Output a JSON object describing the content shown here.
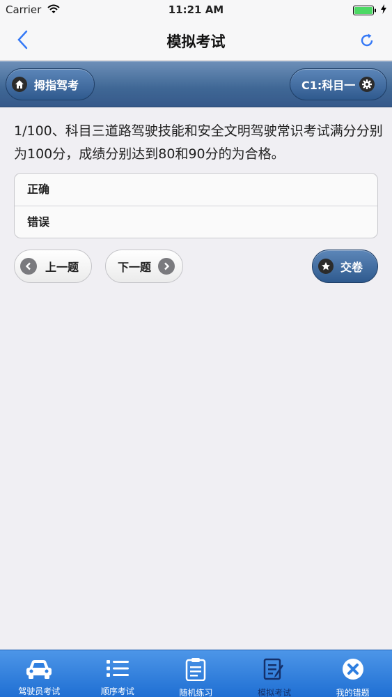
{
  "status_bar": {
    "carrier": "Carrier",
    "time": "11:21 AM"
  },
  "nav": {
    "title": "模拟考试"
  },
  "header": {
    "home_label": "拇指驾考",
    "subject_label": "C1:科目一"
  },
  "question": {
    "text": "1/100、科目三道路驾驶技能和安全文明驾驶常识考试满分分别为100分，成绩分别达到80和90分的为合格。",
    "options": [
      "正确",
      "错误"
    ]
  },
  "controls": {
    "prev_label": "上一题",
    "next_label": "下一题",
    "submit_label": "交卷"
  },
  "tabs": [
    {
      "label": "驾驶员考试",
      "icon": "car-icon"
    },
    {
      "label": "顺序考试",
      "icon": "list-icon"
    },
    {
      "label": "随机练习",
      "icon": "clipboard-icon"
    },
    {
      "label": "模拟考试",
      "icon": "exam-edit-icon",
      "active": true
    },
    {
      "label": "我的错题",
      "icon": "wrong-x-icon"
    }
  ],
  "colors": {
    "header_blue": "#3f6795",
    "tab_blue": "#2f7fe0",
    "tab_active": "#14306a",
    "accent": "#3478f6"
  }
}
